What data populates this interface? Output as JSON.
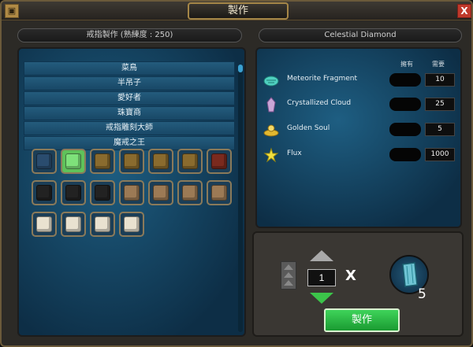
{
  "window": {
    "title": "製作",
    "close_label": "X"
  },
  "left_header": "戒指製作 (熟練度 : 250)",
  "right_header": "Celestial Diamond",
  "recipe_categories": [
    {
      "label": "菜鳥"
    },
    {
      "label": "半吊子"
    },
    {
      "label": "愛好者"
    },
    {
      "label": "珠寶商"
    },
    {
      "label": "戒指雕刻大師"
    },
    {
      "label": "魔戒之王"
    }
  ],
  "recipe_slots": [
    {
      "icon": "dark-ring-icon",
      "color": "#2a4c6e"
    },
    {
      "icon": "green-ring-icon",
      "color": "#7ee17a"
    },
    {
      "icon": "ring-cube-icon",
      "color": "#8a6b2e"
    },
    {
      "icon": "ring-cube-icon",
      "color": "#8a6b2e"
    },
    {
      "icon": "ring-cube-icon",
      "color": "#8a6b2e"
    },
    {
      "icon": "ring-cube-icon",
      "color": "#8a6b2e"
    },
    {
      "icon": "ring-cube-icon",
      "color": "#7a2a1e"
    },
    {
      "icon": "black-cube-icon",
      "color": "#222222"
    },
    {
      "icon": "black-cube-icon",
      "color": "#222222"
    },
    {
      "icon": "black-cube-icon",
      "color": "#222222"
    },
    {
      "icon": "tan-cube-icon",
      "color": "#9c7a55"
    },
    {
      "icon": "tan-cube-icon",
      "color": "#9c7a55"
    },
    {
      "icon": "tan-cube-icon",
      "color": "#9c7a55"
    },
    {
      "icon": "tan-cube-icon",
      "color": "#9c7a55"
    },
    {
      "icon": "white-cube-icon",
      "color": "#e9e2d0"
    },
    {
      "icon": "white-cube-icon",
      "color": "#e9e2d0"
    },
    {
      "icon": "white-cube-icon",
      "color": "#e9e2d0"
    },
    {
      "icon": "white-cube-icon",
      "color": "#e9e2d0"
    }
  ],
  "materials": {
    "col_owned": "擁有",
    "col_needed": "需要",
    "items": [
      {
        "name": "Meteorite Fragment",
        "needed": "10",
        "icon": "meteorite-icon",
        "color": "#4fd0c0"
      },
      {
        "name": "Crystallized Cloud",
        "needed": "25",
        "icon": "crystal-cloud-icon",
        "color": "#c9a6d6"
      },
      {
        "name": "Golden Soul",
        "needed": "5",
        "icon": "golden-soul-icon",
        "color": "#e2b830"
      },
      {
        "name": "Flux",
        "needed": "1000",
        "icon": "flux-icon",
        "color": "#f2e040"
      }
    ]
  },
  "craft": {
    "quantity": "1",
    "multiply": "X",
    "result_count": "5",
    "button_label": "製作"
  }
}
